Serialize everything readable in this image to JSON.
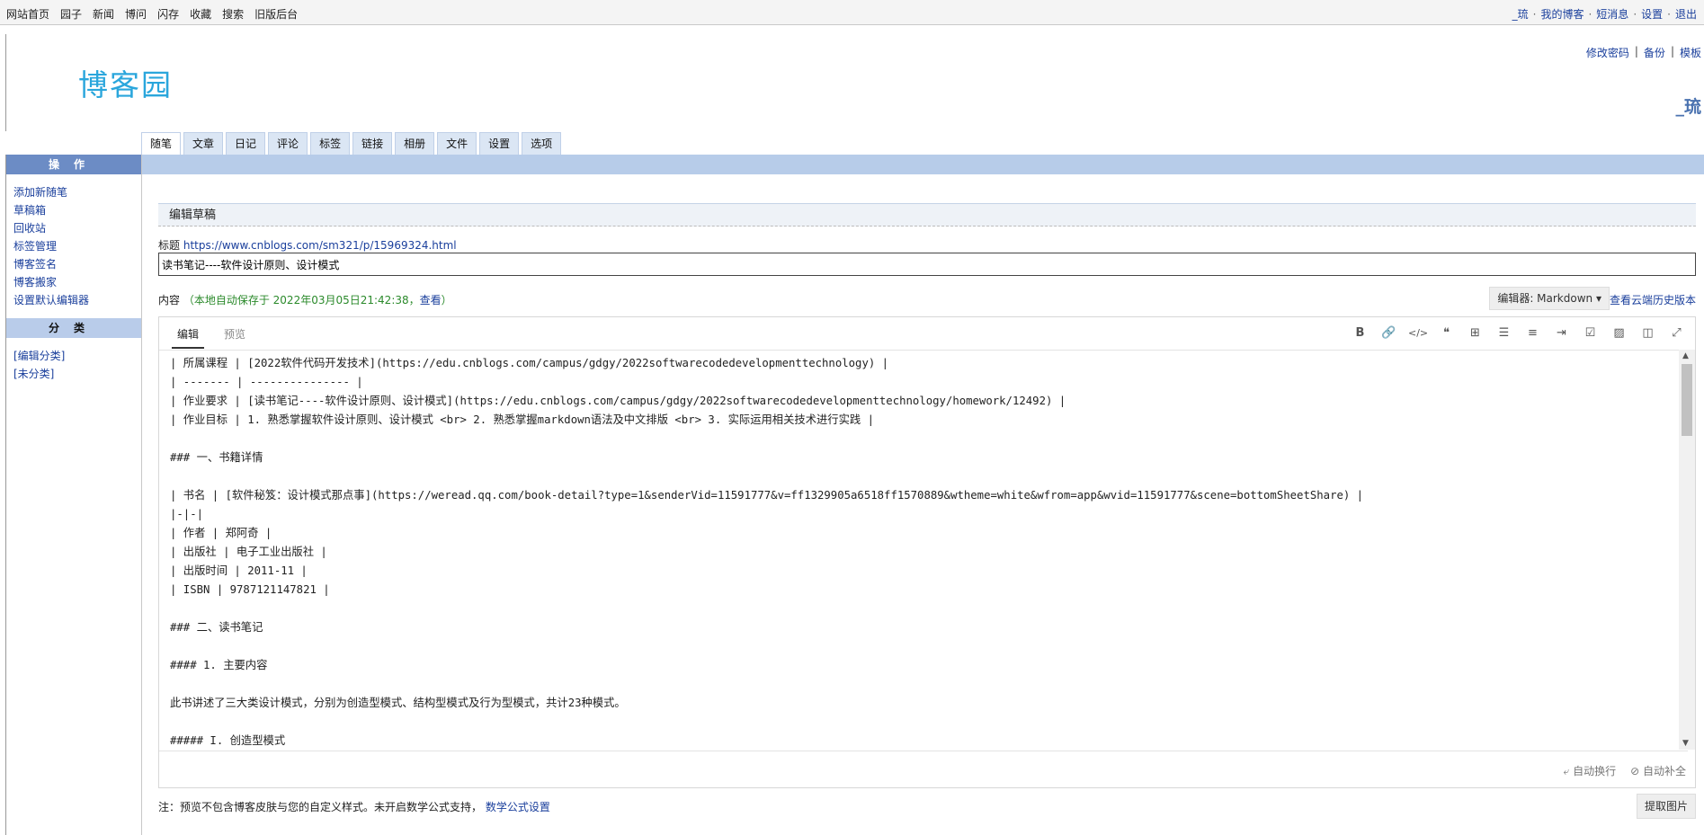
{
  "topnav": {
    "items": [
      "网站首页",
      "园子",
      "新闻",
      "博问",
      "闪存",
      "收藏",
      "搜索",
      "旧版后台"
    ],
    "user": "_琉",
    "right_links": [
      "我的博客",
      "短消息",
      "设置",
      "退出"
    ]
  },
  "header": {
    "logo": "博客园",
    "links": [
      "修改密码",
      "备份",
      "模板"
    ],
    "username": "_琉"
  },
  "tabs": [
    "随笔",
    "文章",
    "日记",
    "评论",
    "标签",
    "链接",
    "相册",
    "文件",
    "设置",
    "选项"
  ],
  "sidebar": {
    "ops_title": "操作",
    "ops_items": [
      "添加新随笔",
      "草稿箱",
      "回收站",
      "标签管理",
      "博客签名",
      "博客搬家",
      "设置默认编辑器"
    ],
    "cat_title": "分类",
    "cat_items": [
      "[编辑分类]",
      "[未分类]"
    ]
  },
  "editor": {
    "section_title": "编辑草稿",
    "title_label": "标题",
    "title_link": "https://www.cnblogs.com/sm321/p/15969324.html",
    "title_value": "读书笔记----软件设计原则、设计模式",
    "content_label": "内容",
    "autosave": "（本地自动保存于 2022年03月05日21:42:38，",
    "autosave_view": "查看",
    "autosave_end": "）",
    "editor_select": "编辑器: Markdown",
    "cloud_history": "查看云端历史版本",
    "tab_edit": "编辑",
    "tab_preview": "预览",
    "toolbar": {
      "bold": "B",
      "link": "🔗",
      "code": "</>",
      "quote": "❝",
      "table": "⊞",
      "ul": "☰",
      "ol": "≡",
      "indent": "⇥",
      "task": "☑",
      "image": "▨",
      "split": "◫",
      "fullscreen": "⤢"
    },
    "content_text": "| 所属课程 | [2022软件代码开发技术](https://edu.cnblogs.com/campus/gdgy/2022softwarecodedevelopmenttechnology) |\n| ------- | --------------- |\n| 作业要求 | [读书笔记----软件设计原则、设计模式](https://edu.cnblogs.com/campus/gdgy/2022softwarecodedevelopmenttechnology/homework/12492) |\n| 作业目标 | 1. 熟悉掌握软件设计原则、设计模式 <br> 2. 熟悉掌握markdown语法及中文排版 <br> 3. 实际运用相关技术进行实践 |\n\n### 一、书籍详情\n\n| 书名 | [软件秘笈：设计模式那点事](https://weread.qq.com/book-detail?type=1&senderVid=11591777&v=ff1329905a6518ff1570889&wtheme=white&wfrom=app&wvid=11591777&scene=bottomSheetShare) |\n|-|-|\n| 作者 | 郑阿奇 |\n| 出版社 | 电子工业出版社 |\n| 出版时间 | 2011-11 |\n| ISBN | 9787121147821 |\n\n### 二、读书笔记\n\n#### 1. 主要内容\n\n此书讲述了三大类设计模式，分别为创造型模式、结构型模式及行为型模式，共计23种模式。\n\n##### I. 创造型模式",
    "status_wrap": "自动换行",
    "status_complete": "自动补全"
  },
  "footer": {
    "note": "注：预览不包含博客皮肤与您的自定义样式。未开启数学公式支持，",
    "math_link": "数学公式设置",
    "extract_button": "提取图片"
  }
}
